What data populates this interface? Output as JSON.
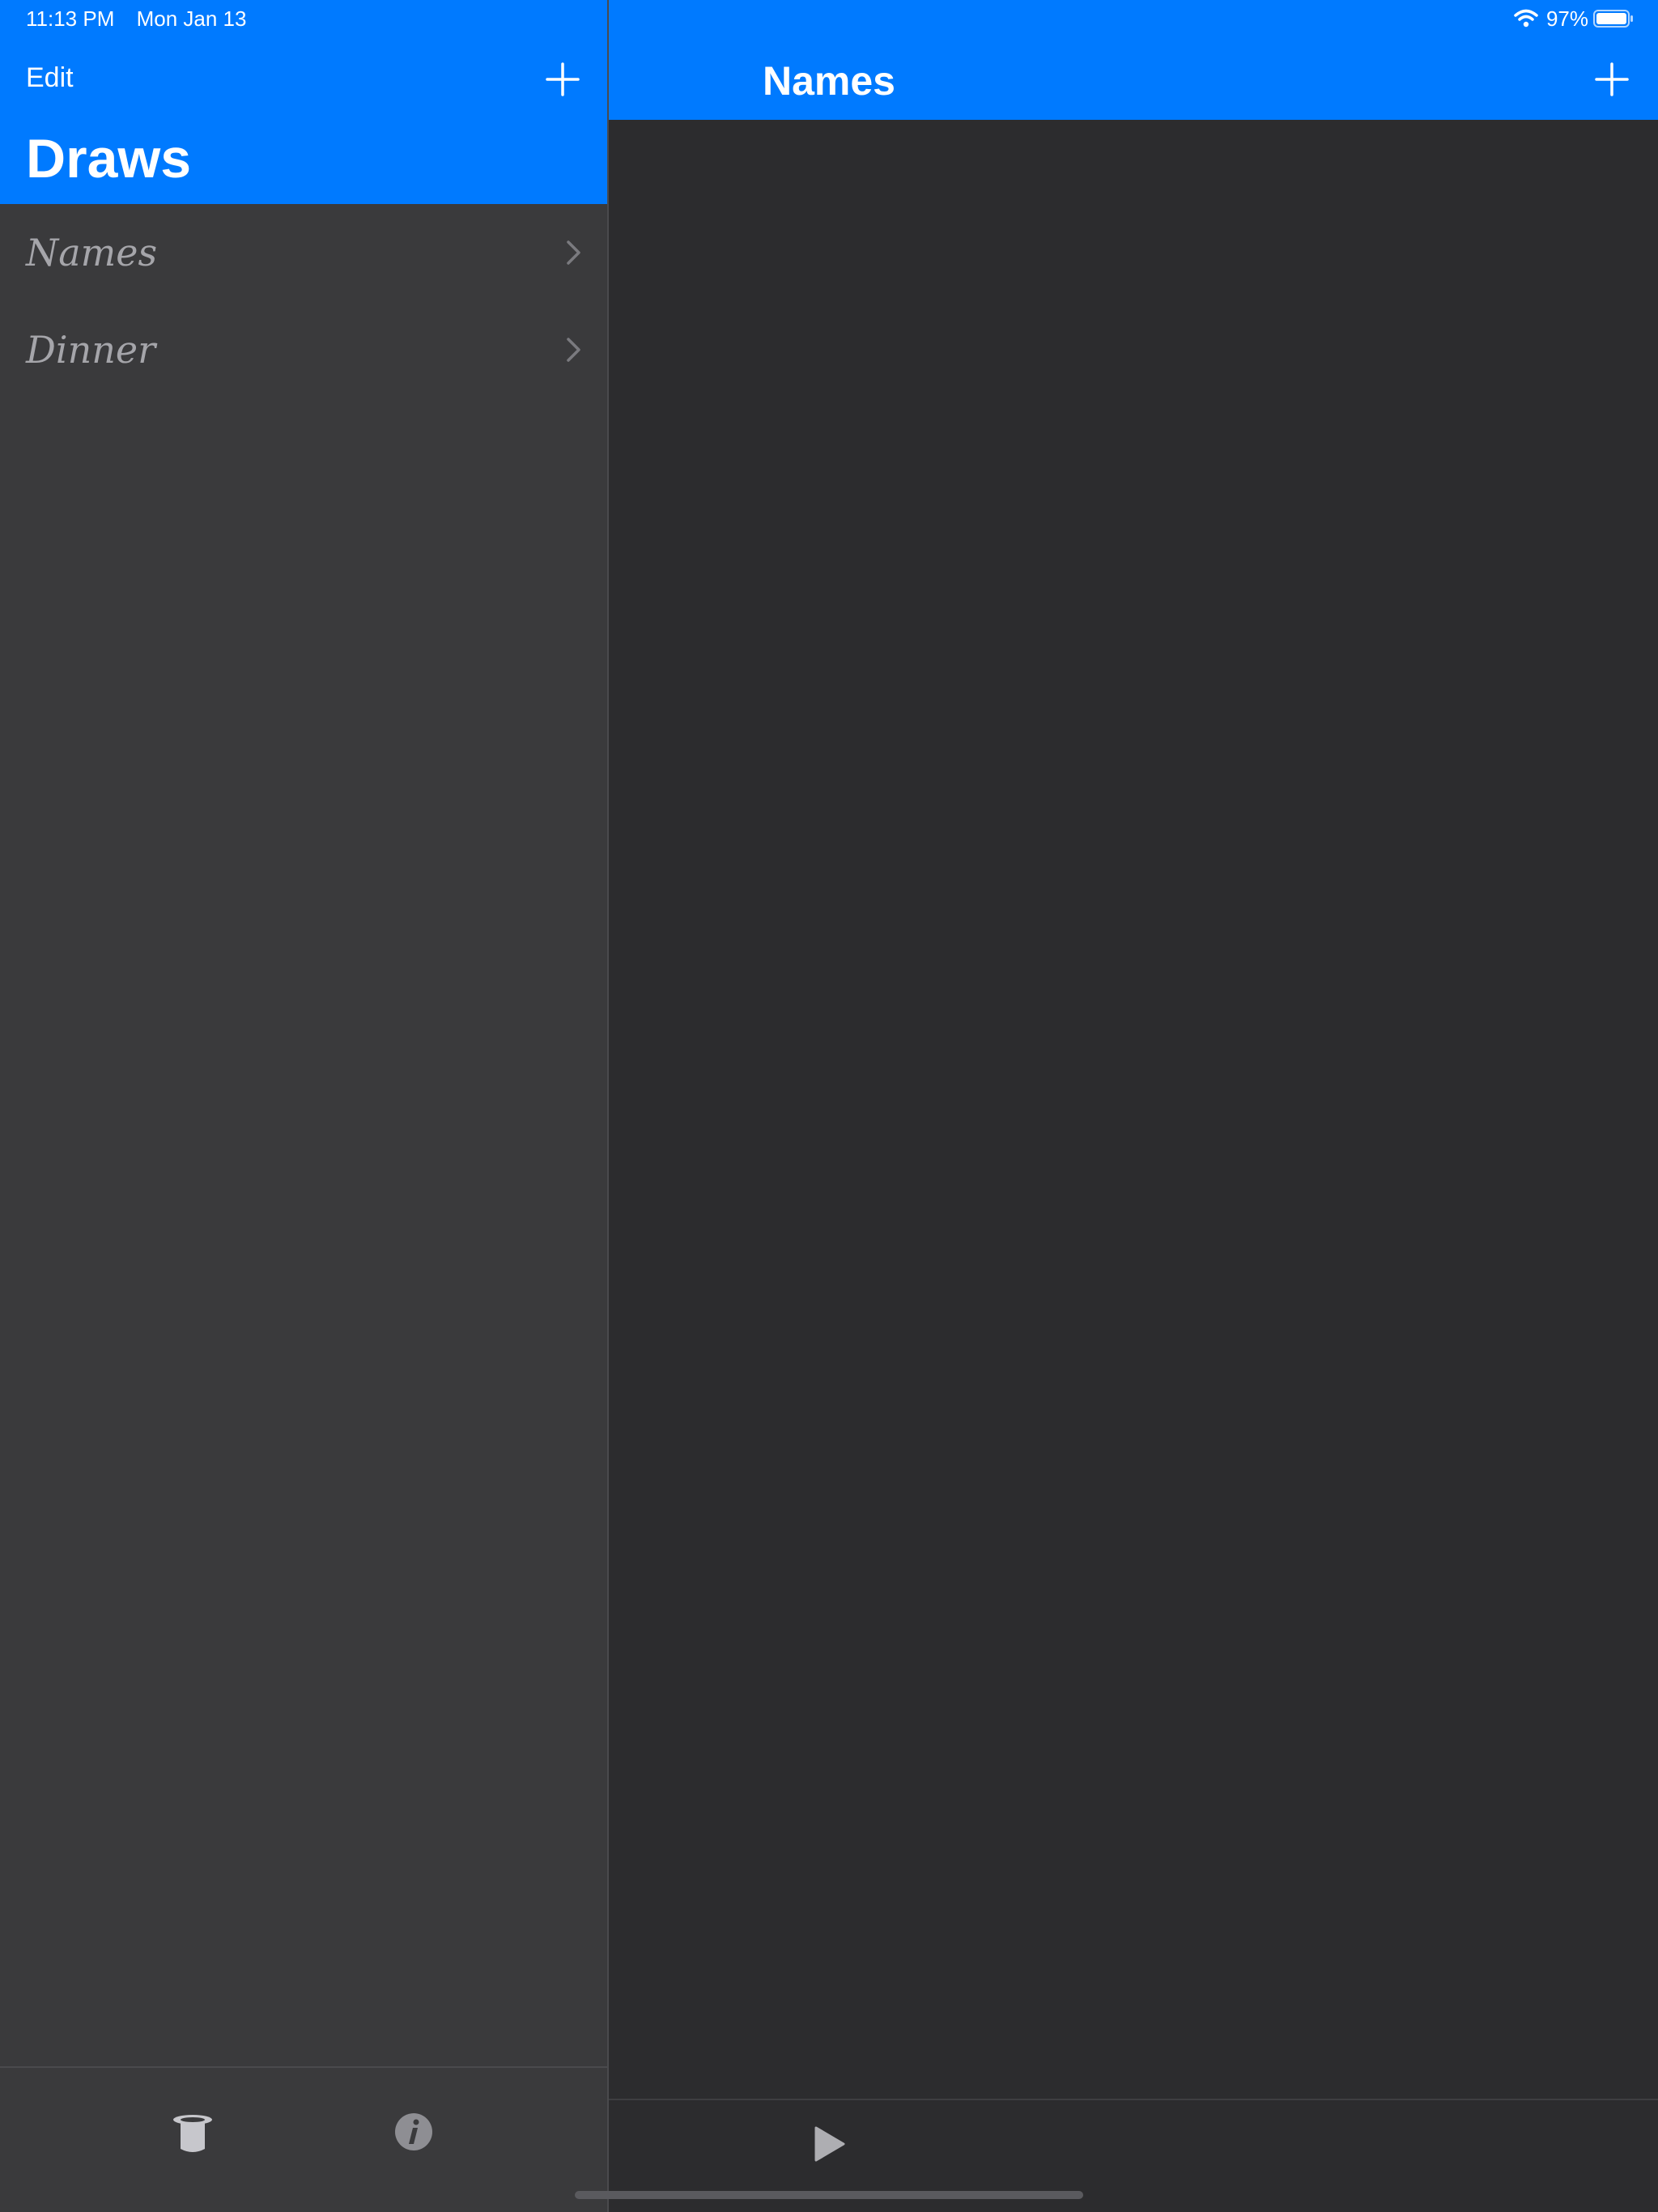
{
  "status_bar": {
    "time": "11:13 PM",
    "date": "Mon Jan 13",
    "battery": "97%",
    "wifi_icon": "wifi-icon",
    "battery_icon": "battery-icon"
  },
  "master": {
    "edit_label": "Edit",
    "add_icon": "plus-icon",
    "title": "Draws",
    "items": [
      {
        "label": "Names"
      },
      {
        "label": "Dinner"
      }
    ],
    "toolbar": {
      "left_icon": "top-hat-icon",
      "right_icon": "info-icon"
    }
  },
  "detail": {
    "title": "Names",
    "add_icon": "plus-icon",
    "toolbar": {
      "play_icon": "play-icon"
    }
  },
  "colors": {
    "accent": "#007aff",
    "master_bg": "#3a3a3c",
    "detail_bg": "#2c2c2e",
    "list_text": "#a5a5aa"
  }
}
